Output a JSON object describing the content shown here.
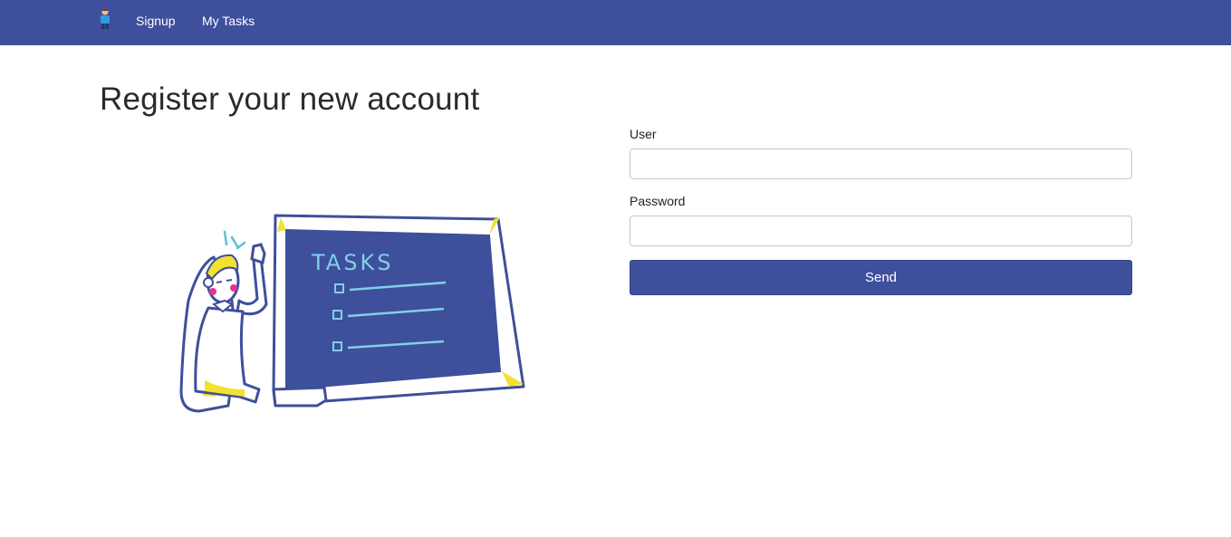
{
  "navbar": {
    "brand_icon": "person-avatar-icon",
    "links": [
      {
        "label": "Signup"
      },
      {
        "label": "My Tasks"
      }
    ],
    "background": "#3e4f9c"
  },
  "page": {
    "title": "Register your new account"
  },
  "illustration": {
    "board_text": "TASKS",
    "icon": "person-with-task-board-illustration"
  },
  "form": {
    "user": {
      "label": "User",
      "value": "",
      "placeholder": ""
    },
    "password": {
      "label": "Password",
      "value": "",
      "placeholder": ""
    },
    "submit_label": "Send"
  },
  "colors": {
    "accent": "#3e4f9c",
    "highlight": "#f2e12e",
    "teal": "#5bc0d6"
  }
}
